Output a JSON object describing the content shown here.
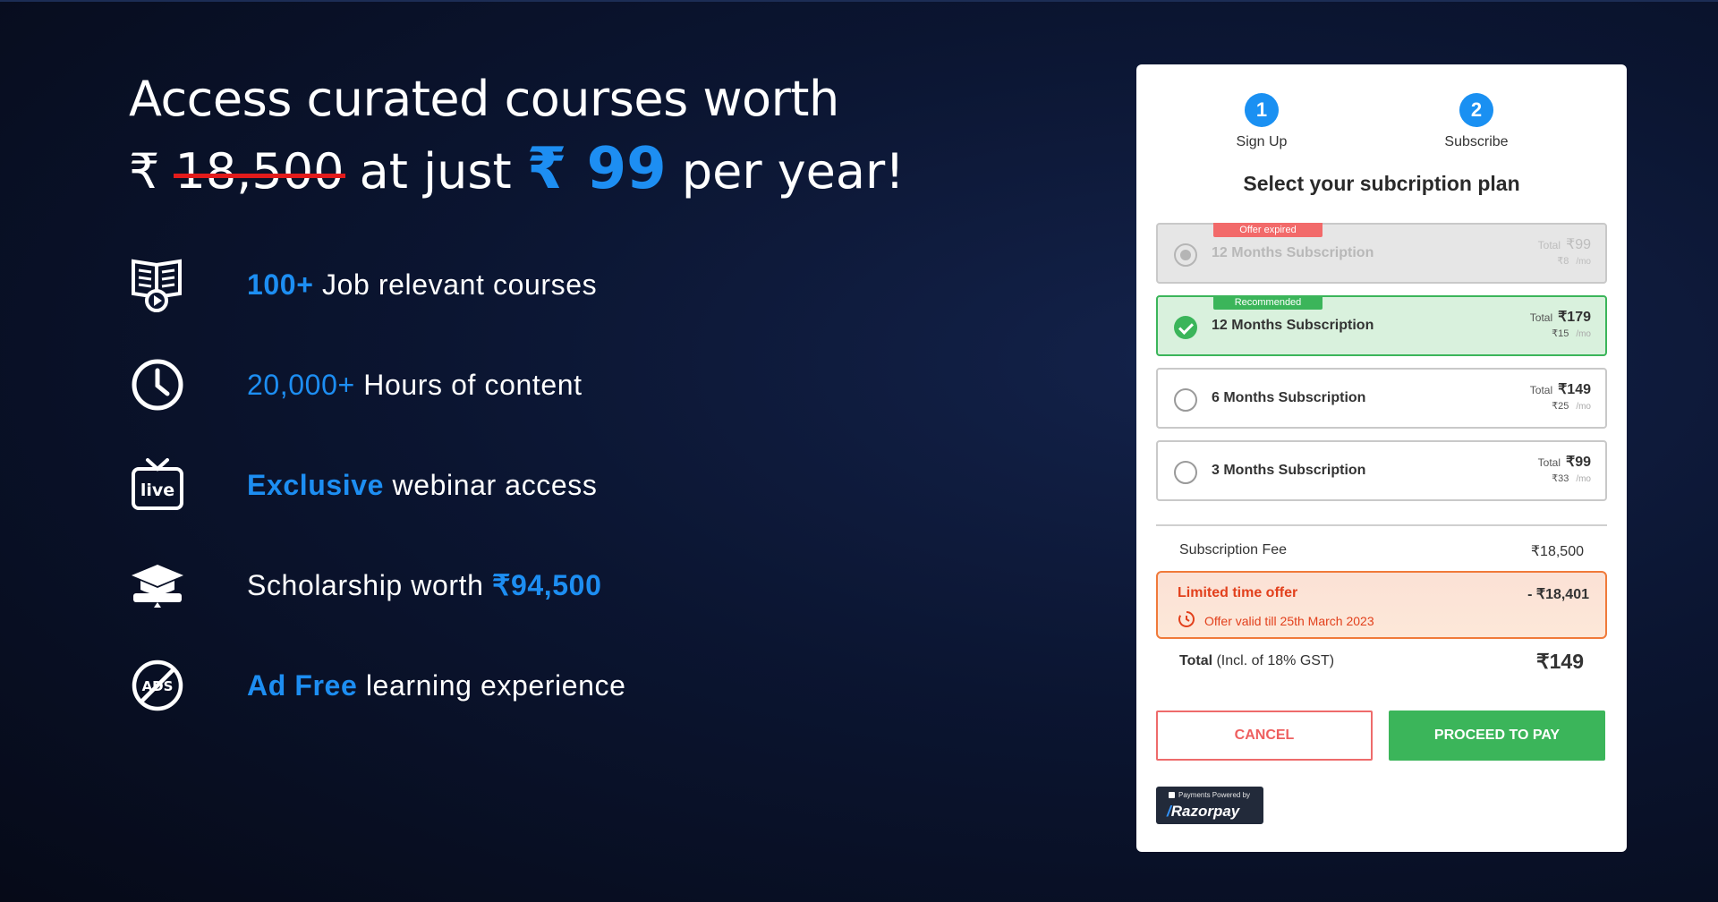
{
  "hero": {
    "line1": "Access curated courses worth",
    "rupee1": "₹",
    "old_price": "18,500",
    "at_just": "at just",
    "new_price": "₹ 99",
    "per_year": "per year!"
  },
  "features": [
    {
      "icon": "book-play-icon",
      "highlight": "100+",
      "text": " Job relevant courses"
    },
    {
      "icon": "clock-icon",
      "highlight": "20,000+",
      "text": " Hours of content"
    },
    {
      "icon": "live-tv-icon",
      "highlight": "Exclusive",
      "text": " webinar access"
    },
    {
      "icon": "graduation-cap-icon",
      "text": "Scholarship worth ",
      "highlight": "₹94,500"
    },
    {
      "icon": "no-ads-icon",
      "highlight": "Ad Free",
      "text": " learning experience"
    }
  ],
  "steps": [
    {
      "number": "1",
      "label": "Sign Up"
    },
    {
      "number": "2",
      "label": "Subscribe"
    }
  ],
  "plan_title": "Select your subcription plan",
  "plans": [
    {
      "tag": "Offer expired",
      "name": "12 Months Subscription",
      "total_label": "Total",
      "total": "₹99",
      "monthly": "₹8",
      "per": "/mo",
      "state": "expired"
    },
    {
      "tag": "Recommended",
      "name": "12 Months Subscription",
      "total_label": "Total",
      "total": "₹179",
      "monthly": "₹15",
      "per": "/mo",
      "state": "selected"
    },
    {
      "name": "6 Months Subscription",
      "total_label": "Total",
      "total": "₹149",
      "monthly": "₹25",
      "per": "/mo",
      "state": "default"
    },
    {
      "name": "3 Months Subscription",
      "total_label": "Total",
      "total": "₹99",
      "monthly": "₹33",
      "per": "/mo",
      "state": "default"
    }
  ],
  "summary": {
    "fee_label": "Subscription Fee",
    "fee_value": "₹18,500",
    "offer_label": "Limited time offer",
    "offer_value": "- ₹18,401",
    "offer_valid": "Offer valid till 25th March 2023",
    "total_label": "Total",
    "total_note": " (Incl. of 18% GST)",
    "total_value": "₹149"
  },
  "buttons": {
    "cancel": "CANCEL",
    "pay": "PROCEED TO PAY"
  },
  "razorpay": {
    "powered": "Payments Powered by",
    "brand": "Razorpay"
  },
  "colors": {
    "accent": "#1d8ef2",
    "success": "#3bb55a",
    "danger": "#ee5f5f",
    "offer": "#e2401c"
  }
}
